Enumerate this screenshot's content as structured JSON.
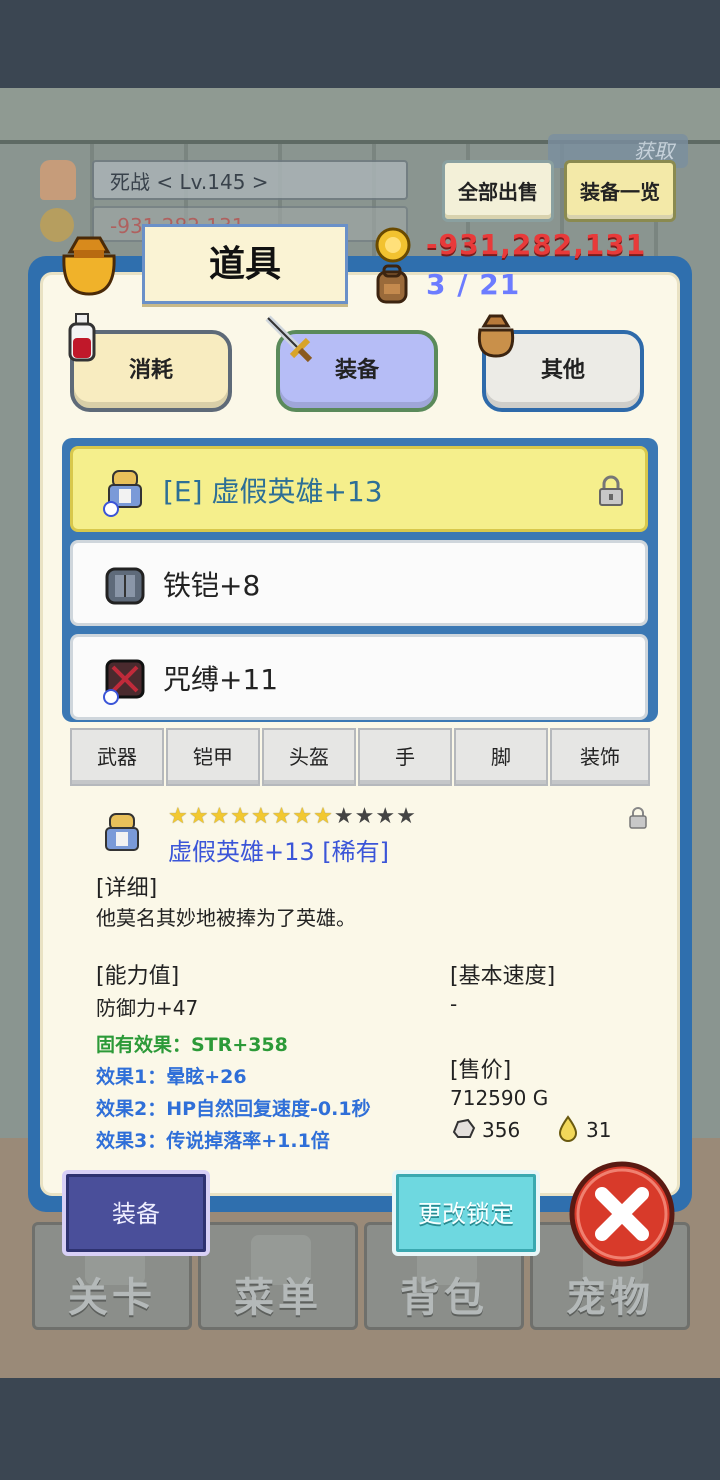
{
  "background": {
    "player_name": "死战  < Lv.145 >",
    "player_hp": "-931,282,131",
    "fetch_label": "获取",
    "sell_all": "全部出售",
    "equip_list": "装备一览",
    "nav": [
      "关卡",
      "菜单",
      "背包",
      "宠物"
    ]
  },
  "panel": {
    "title": "道具",
    "gold": "-931,282,131",
    "capacity": "3 / 21"
  },
  "categories": [
    "消耗",
    "装备",
    "其他"
  ],
  "items": [
    {
      "name": "[E] 虚假英雄+13",
      "selected": true,
      "locked": true
    },
    {
      "name": "铁铠+8"
    },
    {
      "name": "咒缚+11"
    }
  ],
  "slots": [
    "武器",
    "铠甲",
    "头盔",
    "手",
    "脚",
    "装饰"
  ],
  "detail": {
    "stars_filled": 8,
    "stars_total": 12,
    "name": "虚假英雄+13 [稀有]",
    "detail_header": "[详细]",
    "description": "他莫名其妙地被捧为了英雄。",
    "stats_header": "[能力值]",
    "defense": "防御力+47",
    "inherent": "固有效果：STR+358",
    "effect1": "效果1：晕眩+26",
    "effect2": "效果2：HP自然回复速度-0.1秒",
    "effect3": "效果3：传说掉落率+1.1倍",
    "speed_header": "[基本速度]",
    "speed": "-",
    "price_header": "[售价]",
    "price": "712590 G",
    "stone": "356",
    "drop": "31"
  },
  "actions": {
    "equip": "装备",
    "lock": "更改锁定"
  },
  "colors": {
    "panel_blue": "#2f6fae",
    "gold_red": "#e83a3a",
    "count_blue": "#6c7cff",
    "selected_row": "#f5ef8c",
    "rare_blue": "#3b55d8",
    "inherent_green": "#2c9a38",
    "effect_blue": "#2f6fd8"
  }
}
